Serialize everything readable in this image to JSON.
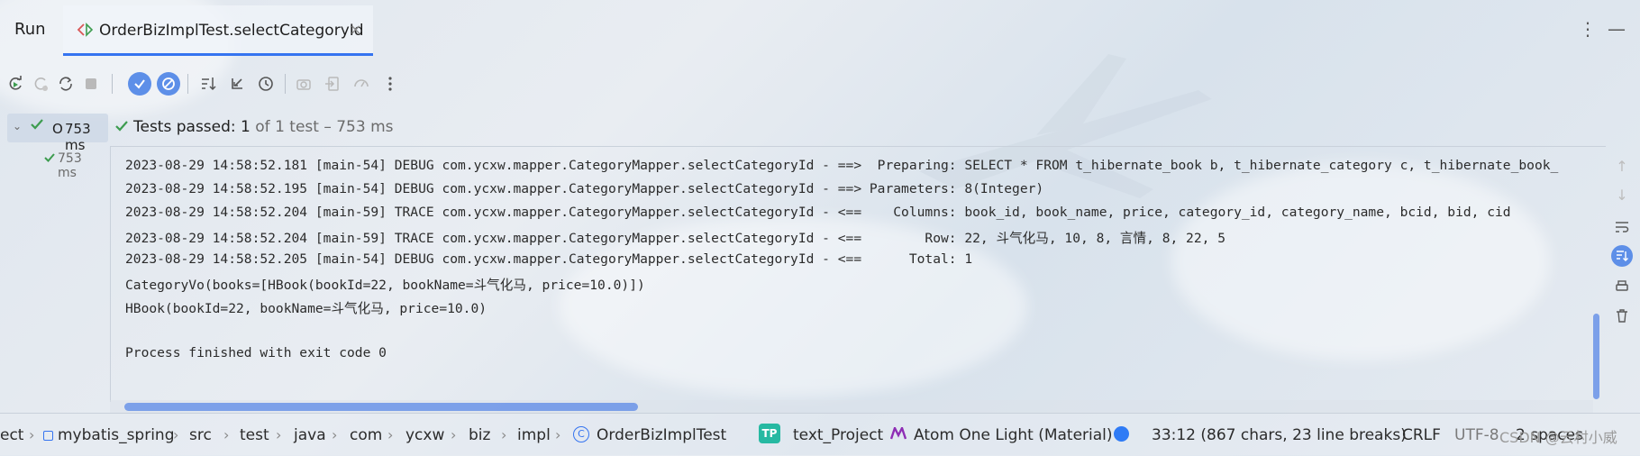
{
  "window": {
    "run_label": "Run",
    "tab": {
      "title": "OrderBizImplTest.selectCategoryId",
      "close": "×"
    },
    "menu_icon": "more-vertical-icon",
    "minimize_icon": "minimize-icon"
  },
  "toolbar": {
    "icons": [
      "rerun-icon",
      "rerun-failed-icon",
      "toggle-auto-test-icon",
      "stop-icon",
      "show-passed-icon",
      "show-ignored-icon",
      "sort-alpha-icon",
      "sort-duration-icon",
      "history-icon",
      "screenshot-icon",
      "import-icon",
      "coverage-icon",
      "more-icon"
    ]
  },
  "tree": {
    "root": {
      "name": "O",
      "time": "753 ms",
      "status": "passed"
    },
    "child": {
      "time": "753 ms",
      "status": "passed"
    }
  },
  "status": {
    "label": "Tests passed:",
    "count": "1",
    "rest": "of 1 test – 753 ms"
  },
  "console": {
    "lines": [
      "2023-08-29 14:58:52.181 [main-54] DEBUG com.ycxw.mapper.CategoryMapper.selectCategoryId - ==>  Preparing: SELECT * FROM t_hibernate_book b, t_hibernate_category c, t_hibernate_book_",
      "2023-08-29 14:58:52.195 [main-54] DEBUG com.ycxw.mapper.CategoryMapper.selectCategoryId - ==> Parameters: 8(Integer)",
      "2023-08-29 14:58:52.204 [main-59] TRACE com.ycxw.mapper.CategoryMapper.selectCategoryId - <==    Columns: book_id, book_name, price, category_id, category_name, bcid, bid, cid",
      "2023-08-29 14:58:52.204 [main-59] TRACE com.ycxw.mapper.CategoryMapper.selectCategoryId - <==        Row: 22, 斗气化马, 10, 8, 言情, 8, 22, 5",
      "2023-08-29 14:58:52.205 [main-54] DEBUG com.ycxw.mapper.CategoryMapper.selectCategoryId - <==      Total: 1",
      "CategoryVo(books=[HBook(bookId=22, bookName=斗气化马, price=10.0)])",
      "HBook(bookId=22, bookName=斗气化马, price=10.0)",
      "",
      "Process finished with exit code 0"
    ]
  },
  "statusbar": {
    "breadcrumbs": [
      "ect",
      "mybatis_spring",
      "src",
      "test",
      "java",
      "com",
      "ycxw",
      "biz",
      "impl",
      "OrderBizImplTest"
    ],
    "project_badge": "TP",
    "project": "text_Project",
    "theme": "Atom One Light (Material)",
    "position": "33:12 (867 chars, 23 line breaks)",
    "line_sep": "CRLF",
    "encoding": "UTF-8",
    "indent": "2 spaces",
    "watermark": "CSDN @云村小威"
  },
  "colors": {
    "accent": "#3574f0",
    "passed": "#3d9c4f",
    "teal_badge": "#26b9a2"
  }
}
